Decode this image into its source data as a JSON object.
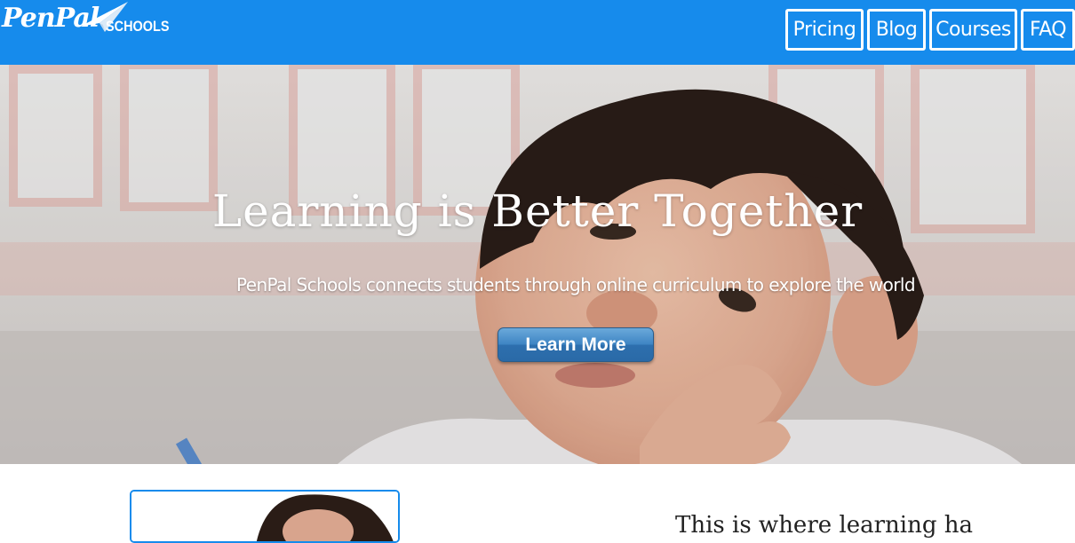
{
  "brand": {
    "name_part1": "PenPal",
    "name_part2": "SCHOOLS",
    "color": "#168bec"
  },
  "nav": {
    "items": [
      {
        "label": "Pricing"
      },
      {
        "label": "Blog"
      },
      {
        "label": "Courses"
      },
      {
        "label": "FAQ"
      }
    ]
  },
  "hero": {
    "title": "Learning is Better Together",
    "subtitle": "PenPal Schools connects students through online curriculum to explore the world",
    "cta_label": "Learn More"
  },
  "section": {
    "heading_partial": "This is where learning ha"
  },
  "icons": {
    "logo_mark": "paper-plane-icon"
  }
}
